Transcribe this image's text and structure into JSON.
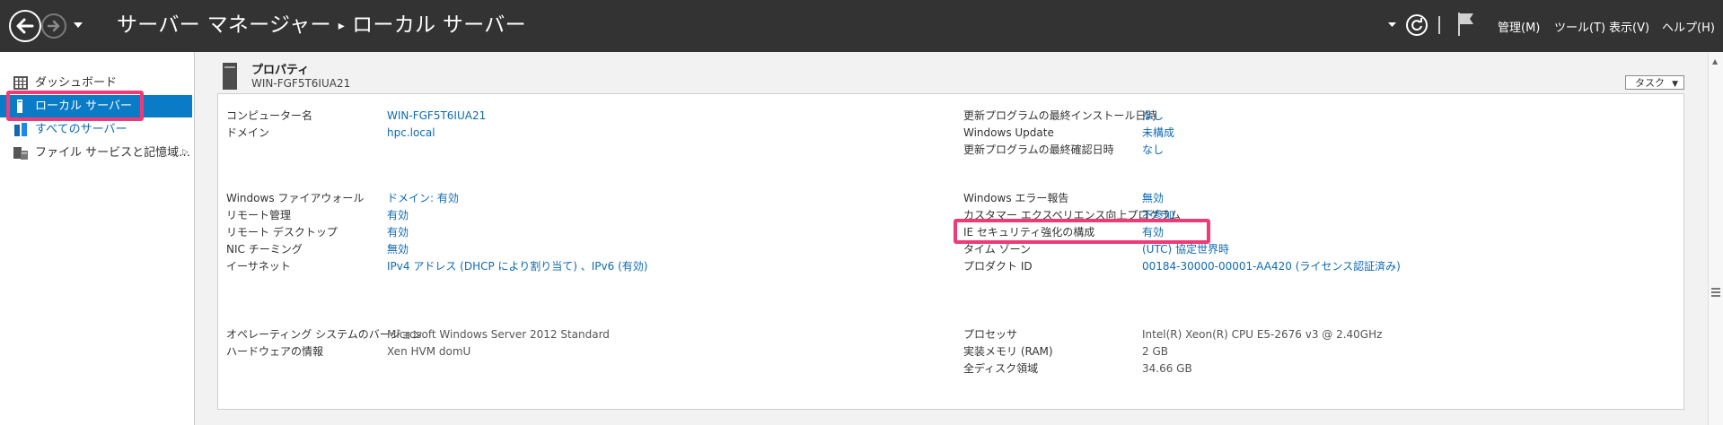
{
  "titlebar": {
    "title": "サーバー マネージャー",
    "separator": "▸",
    "subtitle": "ローカル サーバー",
    "menu": [
      "管理(M)",
      "ツール(T)",
      "表示(V)",
      "ヘルプ(H)"
    ]
  },
  "leftnav": {
    "items": [
      {
        "label": "ダッシュボード",
        "icon": "dashboard-icon"
      },
      {
        "label": "ローカル サーバー",
        "icon": "server-icon",
        "active": true
      },
      {
        "label": "すべてのサーバー",
        "icon": "servers-icon"
      },
      {
        "label": "ファイル サービスと記憶域…",
        "icon": "file-services-icon"
      }
    ]
  },
  "properties": {
    "header": "プロパティ",
    "subheader": "WIN-FGF5T6IUA21",
    "tasks_label": "タスク",
    "left_group1": [
      {
        "label": "コンピューター名",
        "value": "WIN-FGF5T6IUA21"
      },
      {
        "label": "ドメイン",
        "value": "hpc.local"
      }
    ],
    "left_group2": [
      {
        "label": "Windows ファイアウォール",
        "value": "ドメイン: 有効"
      },
      {
        "label": "リモート管理",
        "value": "有効"
      },
      {
        "label": "リモート デスクトップ",
        "value": "有効"
      },
      {
        "label": "NIC チーミング",
        "value": "無効"
      },
      {
        "label": "イーサネット",
        "value": "IPv4 アドレス (DHCP により割り当て) 、IPv6 (有効)"
      }
    ],
    "left_group3": [
      {
        "label": "オペレーティング システムのバージョン",
        "value": "Microsoft Windows Server 2012 Standard"
      },
      {
        "label": "ハードウェアの情報",
        "value": "Xen HVM domU"
      }
    ],
    "right_group1": [
      {
        "label": "更新プログラムの最終インストール日時",
        "value": "なし"
      },
      {
        "label": "Windows Update",
        "value": "未構成"
      },
      {
        "label": "更新プログラムの最終確認日時",
        "value": "なし"
      }
    ],
    "right_group2": [
      {
        "label": "Windows エラー報告",
        "value": "無効"
      },
      {
        "label": "カスタマー エクスペリエンス向上プログラム",
        "value": "不参加"
      },
      {
        "label": "IE セキュリティ強化の構成",
        "value": "有効"
      },
      {
        "label": "タイム ゾーン",
        "value": "(UTC) 協定世界時"
      },
      {
        "label": "プロダクト ID",
        "value": "00184-30000-00001-AA420 (ライセンス認証済み)"
      }
    ],
    "right_group3": [
      {
        "label": "プロセッサ",
        "value": "Intel(R) Xeon(R) CPU E5-2676 v3 @ 2.40GHz"
      },
      {
        "label": "実装メモリ (RAM)",
        "value": "2 GB"
      },
      {
        "label": "全ディスク領域",
        "value": "34.66 GB"
      }
    ]
  },
  "colors": {
    "titlebar": "#333333",
    "accent": "#0a7bc6",
    "link": "#0f6ab4",
    "highlight": "#ee3b78"
  }
}
